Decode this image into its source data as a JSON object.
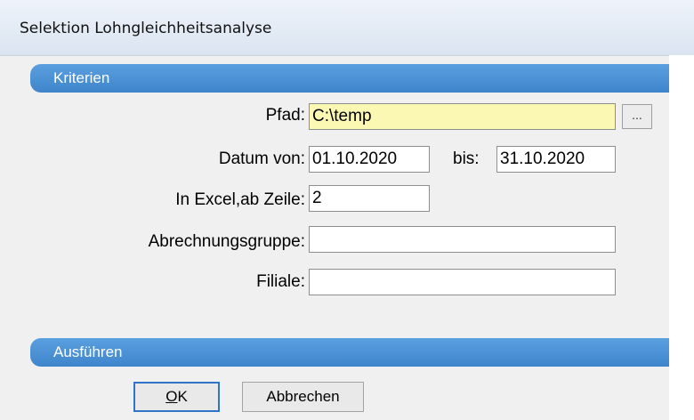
{
  "window": {
    "title": "Selektion Lohngleichheitsanalyse"
  },
  "sections": {
    "criteria": "Kriterien",
    "execute": "Ausführen"
  },
  "form": {
    "path": {
      "label": "Pfad:",
      "value": "C:\\temp",
      "browse_label": "..."
    },
    "date_from": {
      "label": "Datum von:",
      "value": "01.10.2020"
    },
    "date_to": {
      "label": "bis:",
      "value": "31.10.2020"
    },
    "excel_row": {
      "label": "In Excel,ab Zeile:",
      "value": "2"
    },
    "billing_group": {
      "label": "Abrechnungsgruppe:",
      "value": ""
    },
    "branch": {
      "label": "Filiale:",
      "value": ""
    }
  },
  "buttons": {
    "ok": {
      "accel": "O",
      "rest": "K"
    },
    "cancel": "Abbrechen"
  },
  "colors": {
    "section_header": "#4a90d6",
    "path_field_bg": "#fbf8b3",
    "default_button_border": "#2f74c9"
  }
}
